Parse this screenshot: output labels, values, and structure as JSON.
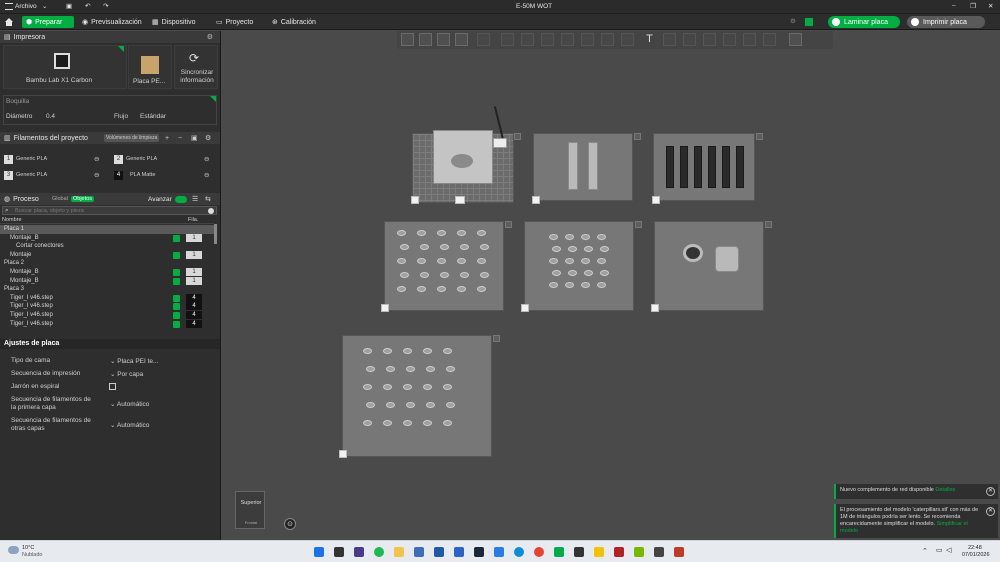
{
  "titlebar": {
    "menu_label": "Archivo",
    "window_title": "E-50M WOT"
  },
  "menubar": {
    "tabs": [
      {
        "label": "Preparar",
        "active": true
      },
      {
        "label": "Previsualización",
        "active": false
      },
      {
        "label": "Dispositivo",
        "active": false
      },
      {
        "label": "Proyecto",
        "active": false
      },
      {
        "label": "Calibración",
        "active": false
      }
    ],
    "slice_button": "Laminar placa",
    "print_button": "Imprimir placa"
  },
  "printer": {
    "section_title": "Impresora",
    "printer_name": "Bambu Lab X1 Carbon",
    "plate_name": "Placa PE...",
    "sync_label_line1": "Sincronizar",
    "sync_label_line2": "información"
  },
  "nozzle": {
    "section_label": "Boquilla",
    "diameter_label": "Diámetro",
    "diameter_value": "0.4",
    "flow_label": "Flujo",
    "flow_value": "Estándar"
  },
  "filaments": {
    "section_title": "Filamentos del proyecto",
    "volume_button": "Volúmenes de limpieza",
    "items": [
      {
        "num": "1",
        "name": "Generic PLA",
        "color": "#e8e8e8"
      },
      {
        "num": "2",
        "name": "Generic PLA",
        "color": "#e8e8e8"
      },
      {
        "num": "3",
        "name": "Generic PLA",
        "color": "#e8e8e8"
      },
      {
        "num": "4",
        "name": "PLA Matte",
        "color": "#111111"
      }
    ]
  },
  "process": {
    "section_title": "Proceso",
    "global_label": "Global",
    "objects_label": "Objetos",
    "advanced_label": "Avanzar",
    "search_placeholder": "Buscar placa, objeto y pieza",
    "col_name": "Nombre",
    "col_fila": "Fila."
  },
  "object_list": [
    {
      "label": "Placa 1",
      "indent": 0,
      "selected": true,
      "check": false,
      "count": ""
    },
    {
      "label": "Montaje_B",
      "indent": 1,
      "selected": false,
      "check": true,
      "count": "1",
      "dark": false
    },
    {
      "label": "Cortar conectores",
      "indent": 2,
      "selected": false,
      "check": false,
      "count": ""
    },
    {
      "label": "Montaje",
      "indent": 1,
      "selected": false,
      "check": true,
      "count": "1",
      "dark": false
    },
    {
      "label": "Placa 2",
      "indent": 0,
      "selected": false,
      "check": false,
      "count": ""
    },
    {
      "label": "Montaje_B",
      "indent": 1,
      "selected": false,
      "check": true,
      "count": "1",
      "dark": false
    },
    {
      "label": "Montaje_B",
      "indent": 1,
      "selected": false,
      "check": true,
      "count": "1",
      "dark": false
    },
    {
      "label": "Placa 3",
      "indent": 0,
      "selected": false,
      "check": false,
      "count": ""
    },
    {
      "label": "Tiger_I v46.step",
      "indent": 1,
      "selected": false,
      "check": true,
      "count": "4",
      "dark": true
    },
    {
      "label": "Tiger_I v46.step",
      "indent": 1,
      "selected": false,
      "check": true,
      "count": "4",
      "dark": true
    },
    {
      "label": "Tiger_I v46.step",
      "indent": 1,
      "selected": false,
      "check": true,
      "count": "4",
      "dark": true
    },
    {
      "label": "Tiger_I v46.step",
      "indent": 1,
      "selected": false,
      "check": true,
      "count": "4",
      "dark": true
    }
  ],
  "plate_settings": {
    "section_title": "Ajustes de placa",
    "bed_type_label": "Tipo de cama",
    "bed_type_value": "Placa PEI te...",
    "print_seq_label": "Secuencia de impresión",
    "print_seq_value": "Por capa",
    "spiral_label": "Jarrón en espiral",
    "first_layer_label_1": "Secuencia de filamentos de",
    "first_layer_label_2": "la primera capa",
    "first_layer_value": "Automático",
    "other_layers_label_1": "Secuencia de filamentos de",
    "other_layers_label_2": "otras capas",
    "other_layers_value": "Automático"
  },
  "viewport": {
    "view_cube_top": "Superior",
    "view_cube_front": "Frontal"
  },
  "notifications": [
    {
      "text": "Nuevo complemento de red disponible",
      "link": "Detalles"
    },
    {
      "text": "El procesamiento del modelo 'caterpillars.stl' con más de 1M de triángulos podría ser lento. Se recomienda encarecidamente simplificar el modelo.",
      "link": "Simplificar el modelo"
    }
  ],
  "taskbar": {
    "weather_temp": "10°C",
    "weather_desc": "Nublado",
    "time": "22:48",
    "date": "07/01/2026"
  },
  "colors": {
    "accent": "#00ae42",
    "panel": "#2e2e2e",
    "viewport": "#4a4a4a"
  }
}
